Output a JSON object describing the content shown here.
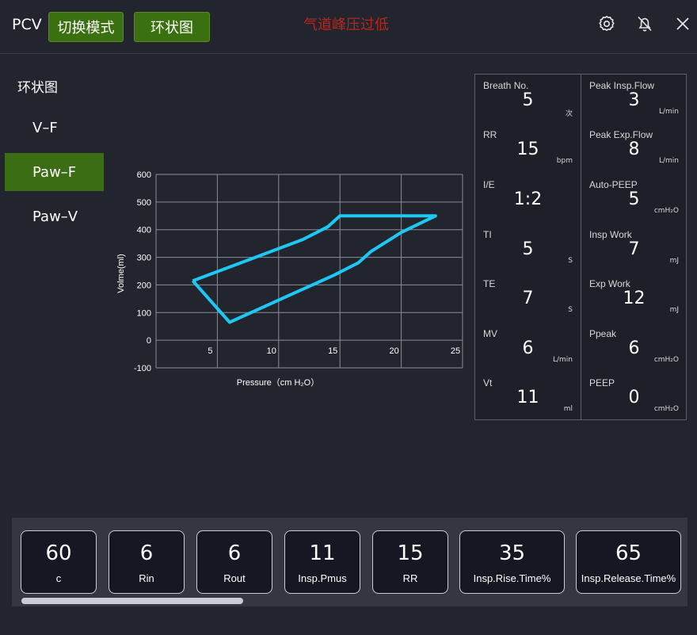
{
  "header": {
    "mode": "PCV",
    "switch_mode_label": "切换模式",
    "loop_label": "环状图",
    "alarm_text": "气道峰压过低",
    "icons": [
      "gear-icon",
      "bell-off-icon",
      "close-icon"
    ]
  },
  "menu": {
    "title": "环状图",
    "items": [
      {
        "label": "V–F",
        "active": false
      },
      {
        "label": "Paw–F",
        "active": true
      },
      {
        "label": "Paw–V",
        "active": false
      }
    ]
  },
  "chart_data": {
    "type": "line",
    "title": "",
    "xlabel": "Pressure（cm H₂O）",
    "ylabel": "Volme(ml)",
    "xlim": [
      0,
      25
    ],
    "ylim": [
      -100,
      600
    ],
    "x_ticks": [
      5,
      10,
      15,
      20,
      25
    ],
    "y_ticks": [
      600,
      500,
      400,
      300,
      200,
      100,
      0,
      -100
    ],
    "grid": true,
    "line_color": "#1ec8f5",
    "series": [
      {
        "points": [
          [
            3.0,
            215
          ],
          [
            7.5,
            290
          ],
          [
            12.0,
            365
          ],
          [
            14.0,
            410
          ],
          [
            15.0,
            450
          ],
          [
            17.5,
            450
          ],
          [
            20.0,
            450
          ],
          [
            22.8,
            450
          ],
          [
            20.0,
            390
          ],
          [
            17.5,
            320
          ],
          [
            16.5,
            280
          ],
          [
            14.5,
            235
          ],
          [
            10.5,
            155
          ],
          [
            6.0,
            65
          ],
          [
            3.0,
            215
          ]
        ]
      }
    ]
  },
  "params": {
    "left": [
      {
        "label": "Breath No.",
        "value": "5",
        "unit": "次"
      },
      {
        "label": "RR",
        "value": "15",
        "unit": "bpm"
      },
      {
        "label": "I/E",
        "value": "1:2",
        "unit": ""
      },
      {
        "label": "TI",
        "value": "5",
        "unit": "S"
      },
      {
        "label": "TE",
        "value": "7",
        "unit": "S"
      },
      {
        "label": "MV",
        "value": "6",
        "unit": "L/min"
      },
      {
        "label": "Vt",
        "value": "11",
        "unit": "ml"
      }
    ],
    "right": [
      {
        "label": "Peak Insp.Flow",
        "value": "3",
        "unit": "L/min"
      },
      {
        "label": "Peak Exp.Flow",
        "value": "8",
        "unit": "L/min"
      },
      {
        "label": "Auto-PEEP",
        "value": "5",
        "unit": "cmH₂O"
      },
      {
        "label": "Insp Work",
        "value": "7",
        "unit": "mJ"
      },
      {
        "label": "Exp Work",
        "value": "12",
        "unit": "mJ"
      },
      {
        "label": "Ppeak",
        "value": "6",
        "unit": "cmH₂O"
      },
      {
        "label": "PEEP",
        "value": "0",
        "unit": "cmH₂O"
      }
    ]
  },
  "cards": [
    {
      "value": "60",
      "label": "c"
    },
    {
      "value": "6",
      "label": "Rin"
    },
    {
      "value": "6",
      "label": "Rout"
    },
    {
      "value": "11",
      "label": "Insp.Pmus"
    },
    {
      "value": "15",
      "label": "RR"
    },
    {
      "value": "35",
      "label": "Insp.Rise.Time%"
    },
    {
      "value": "65",
      "label": "Insp.Release.Time%"
    }
  ],
  "colors": {
    "background": "#22252d",
    "active_green": "#3b6e14",
    "alarm_red": "#b5281e",
    "loop_cyan": "#1ec8f5"
  }
}
